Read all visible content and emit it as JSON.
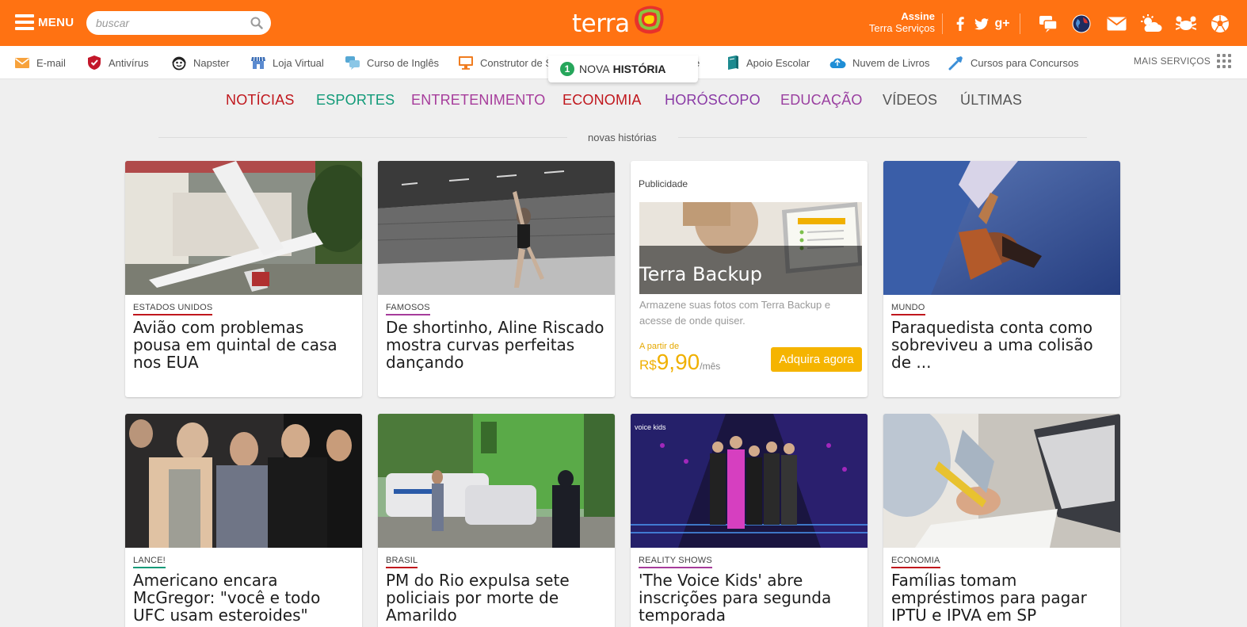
{
  "header": {
    "menu_label": "MENU",
    "search_placeholder": "buscar",
    "logo_text": "terra",
    "assine": "Assine",
    "servicos": "Terra Serviços"
  },
  "services": [
    {
      "label": "E-mail",
      "icon": "email-icon"
    },
    {
      "label": "Antivírus",
      "icon": "shield-icon"
    },
    {
      "label": "Napster",
      "icon": "headphones-icon"
    },
    {
      "label": "Loja Virtual",
      "icon": "store-icon"
    },
    {
      "label": "Curso de Inglês",
      "icon": "chat-icon"
    },
    {
      "label": "Construtor de S",
      "icon": "monitor-icon"
    },
    {
      "label": "e",
      "icon": ""
    },
    {
      "label": "Apoio Escolar",
      "icon": "book-icon"
    },
    {
      "label": "Nuvem de Livros",
      "icon": "cloud-icon"
    },
    {
      "label": "Cursos para Concursos",
      "icon": "tools-icon"
    }
  ],
  "mais_servicos": "MAIS SERVIÇOS",
  "nova_historia": {
    "count": "1",
    "text1": "NOVA",
    "text2": "HISTÓRIA"
  },
  "categories": [
    {
      "label": "NOTÍCIAS",
      "color": "#c0171d"
    },
    {
      "label": "ESPORTES",
      "color": "#119a78"
    },
    {
      "label": "ENTRETENIMENTO",
      "color": "#a63c9b"
    },
    {
      "label": "ECONOMIA",
      "color": "#c0171d"
    },
    {
      "label": "HORÓSCOPO",
      "color": "#8a3aa5"
    },
    {
      "label": "EDUCAÇÃO",
      "color": "#9a3fa0"
    },
    {
      "label": "VÍDEOS",
      "color": "#555555"
    },
    {
      "label": "ÚLTIMAS",
      "color": "#555555"
    }
  ],
  "novas_label": "novas histórias",
  "cards": [
    {
      "tag": "ESTADOS UNIDOS",
      "tag_color": "#c0171d",
      "title": "Avião com problemas pousa em quintal de casa nos EUA"
    },
    {
      "tag": "FAMOSOS",
      "tag_color": "#a63c9b",
      "title": "De shortinho, Aline Riscado mostra curvas perfeitas dançando"
    },
    {
      "tag": "MUNDO",
      "tag_color": "#c0171d",
      "title": "Paraquedista conta como sobreviveu a uma colisão de ..."
    },
    {
      "tag": "LANCE!",
      "tag_color": "#119a78",
      "title": "Americano encara McGregor: \"você e todo UFC usam esteroides\""
    },
    {
      "tag": "BRASIL",
      "tag_color": "#c0171d",
      "title": "PM do Rio expulsa sete policiais por morte de Amarildo"
    },
    {
      "tag": "REALITY SHOWS",
      "tag_color": "#a63c9b",
      "title": "'The Voice Kids' abre inscrições para segunda temporada"
    },
    {
      "tag": "ECONOMIA",
      "tag_color": "#c0171d",
      "title": "Famílias tomam empréstimos para pagar IPTU e IPVA em SP"
    }
  ],
  "ad": {
    "label": "Publicidade",
    "title": "Terra Backup",
    "desc": "Armazene suas fotos com Terra Backup e acesse de onde quiser.",
    "a_partir": "A partir de",
    "currency": "R$",
    "price": "9,90",
    "period": "/mês",
    "button": "Adquira agora"
  }
}
